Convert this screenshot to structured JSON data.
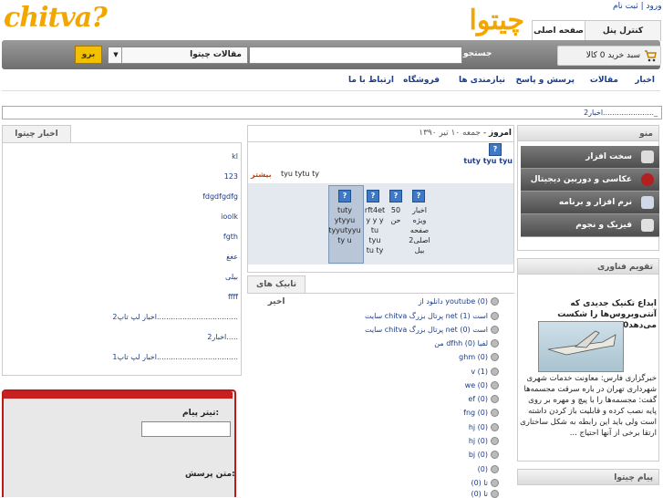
{
  "header": {
    "logo_text": "chitva?",
    "logo_fa": "چیتوا",
    "auth": "ورود | ثبت نام",
    "tabs": [
      "کنترل پنل",
      "صفحه اصلی"
    ]
  },
  "toolbar": {
    "cart": "سبد خرید 0 کالا",
    "search_label": "جستجو",
    "select_value": "مقالات چیتوا",
    "go_label": "برو"
  },
  "nav": {
    "items": [
      "اخبار",
      "مقالات",
      "پرسش و پاسخ",
      "نیازمندی ها",
      "فروشگاه",
      "ارتباط با ما"
    ]
  },
  "ticker": "اخبار2......................_",
  "right": {
    "menu_title": "منو",
    "menu_items": [
      "سخت افزار",
      "عکاسی و دوربین دیجیتال",
      "نرم افزار و برنامه",
      "فیزیک و نجوم"
    ],
    "tech_title": "تقویم فناوری",
    "tech_headline": "ابداع تکنیک جدیدی که آنتی‌ویروس‌ها را شکست می‌دهد1020",
    "tech_body": "خبرگزاری فارس: معاونت خدمات شهری شهرداری تهران در باره سرقت مجسمه‌ها گفت: مجسمه‌ها را با پیچ و مهره بر روی پایه نصب کرده و قابلیت باز کردن داشته است ولی باید این رابطه به شکل ساختاری ارتقا برخی از آنها احتیاج ...",
    "message_title": "پیام چیتوا"
  },
  "center": {
    "date_label": "امروز",
    "date_value": "جمعه ۱۰ تیر ۱۳۹۰",
    "article_title": "tuty tyu tyu",
    "article_summary": "tyu tytu ty",
    "more_label": "بیشتر",
    "icons": [
      [
        "اخبار",
        "ویژه",
        "صفحه",
        "اصلی2",
        "بیل"
      ],
      [
        "50",
        "حن"
      ],
      [
        "rft4et",
        "y y y",
        "tu",
        "tyu",
        "tu ty"
      ],
      [
        "tuty",
        "ytyyu",
        "tyyutyyu",
        "ty u"
      ]
    ],
    "tags_title": "تابیک های اخیر",
    "tags": [
      "دانلود از youtube (0)",
      "سایت chitva پرتال بزرگ net است (1)",
      "سایت chitva پرتال بزرگ net است (0)",
      "من dfhh لفیا (0)",
      "ghm (0)",
      "v (1)",
      "we (0)",
      "ef (0)",
      "fng (0)",
      "hj (0)",
      "hj (0)",
      "bj (0)",
      "(0)",
      "تا (0)",
      "(0) تا"
    ]
  },
  "left": {
    "news_title": "اخبار چیتوا",
    "news_items": [
      "kl",
      "123",
      "fdgdfgdfg",
      "ioolk",
      "fgth",
      "عغغ",
      "بیلی",
      "ffff",
      "اخبار لپ تاپ2...................................",
      "اخبار2.....",
      "اخبار لپ تاپ1..................................."
    ],
    "form_fields": [
      "تیتر پیام:",
      "متن پرسش:"
    ]
  }
}
